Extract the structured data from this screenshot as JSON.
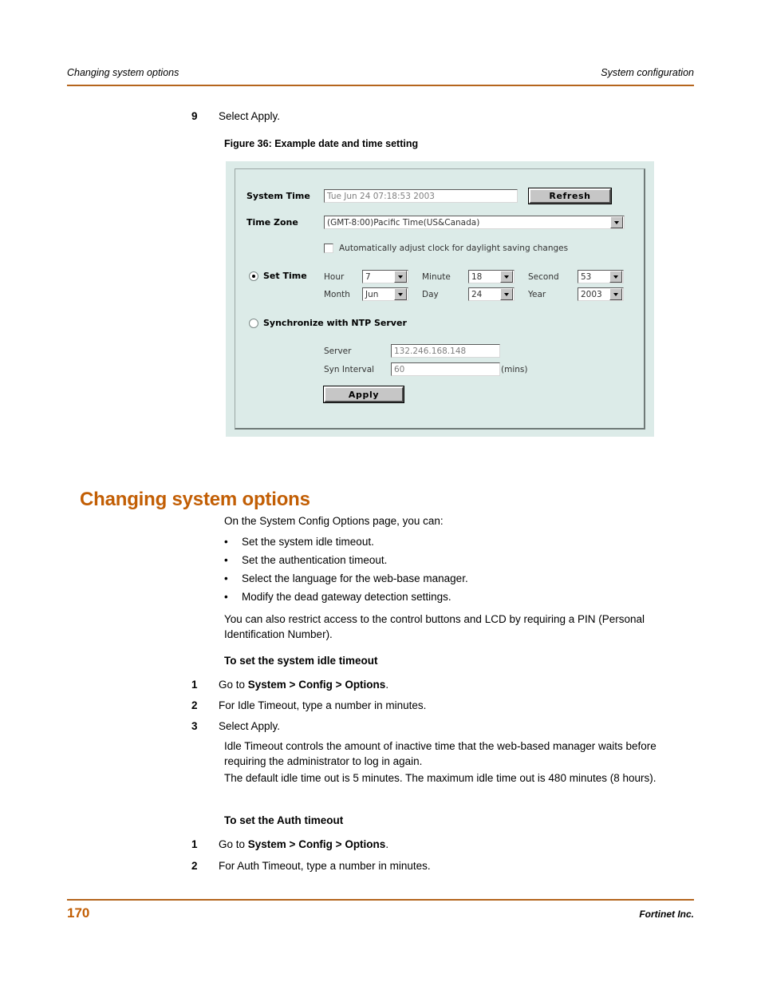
{
  "header": {
    "left": "Changing system options",
    "right": "System configuration",
    "rule_color": "#b5651d"
  },
  "steps_top": [
    {
      "num": "9",
      "text": "Select Apply."
    }
  ],
  "figure": {
    "caption": "Figure 36: Example date and time setting",
    "background": "#dcebe8",
    "fields": {
      "system_time_label": "System Time",
      "system_time_value": "Tue Jun 24 07:18:53 2003",
      "refresh_button": "Refresh",
      "time_zone_label": "Time Zone",
      "time_zone_value": "(GMT-8:00)Pacific Time(US&Canada)",
      "dst_checkbox_label": "Automatically adjust clock for daylight saving changes",
      "dst_checked": false,
      "set_time_radio_label": "Set Time",
      "set_time_selected": true,
      "hour_label": "Hour",
      "hour_value": "7",
      "minute_label": "Minute",
      "minute_value": "18",
      "second_label": "Second",
      "second_value": "53",
      "month_label": "Month",
      "month_value": "Jun",
      "day_label": "Day",
      "day_value": "24",
      "year_label": "Year",
      "year_value": "2003",
      "ntp_radio_label": "Synchronize with NTP Server",
      "ntp_selected": false,
      "server_label": "Server",
      "server_value": "132.246.168.148",
      "syn_interval_label": "Syn Interval",
      "syn_interval_value": "60",
      "syn_interval_units": "(mins)",
      "apply_button": "Apply"
    }
  },
  "section": {
    "heading": "Changing system options",
    "heading_color": "#c25e04",
    "intro": "On the System Config Options page, you can:",
    "bullets": [
      "Set the system idle timeout.",
      "Set the authentication timeout.",
      "Select the language for the web-base manager.",
      "Modify the dead gateway detection settings."
    ],
    "bullet_marker": "•",
    "restrict_note": "You can also restrict access to the control buttons and LCD by requiring a PIN (Personal Identification Number).",
    "idle_procedure": {
      "title": "To set the system idle timeout",
      "step1_prefix": "Go to ",
      "step1_bold": "System > Config > Options",
      "step1_suffix": ".",
      "step1_num": "1",
      "step2_num": "2",
      "step2": "For Idle Timeout, type a number in minutes.",
      "step3_num": "3",
      "step3": "Select Apply.",
      "note1": "Idle Timeout controls the amount of inactive time that the web-based manager waits before requiring the administrator to log in again.",
      "note2": "The default idle time out is 5 minutes. The maximum idle time out is 480 minutes (8 hours)."
    },
    "auth_procedure": {
      "title": "To set the Auth timeout",
      "step1_prefix": "Go to ",
      "step1_bold": "System > Config > Options",
      "step1_suffix": ".",
      "step1_num": "1",
      "step2_num": "2",
      "step2": "For Auth Timeout, type a number in minutes."
    }
  },
  "footer": {
    "page_number": "170",
    "company": "Fortinet Inc."
  }
}
